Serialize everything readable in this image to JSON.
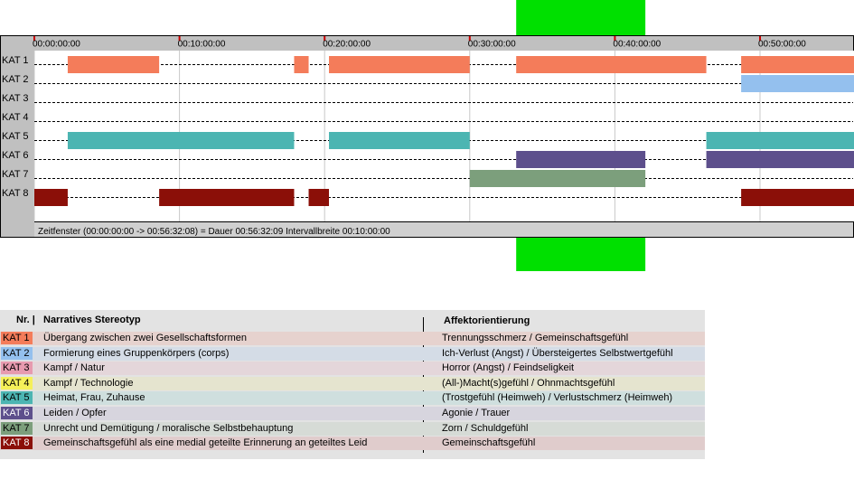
{
  "colors": {
    "highlight": "#00e000",
    "chart_bg": "#ffffff",
    "panel_bg": "#c0c0c0",
    "ruler_tick": "#cc0000"
  },
  "chart_data": {
    "type": "gantt",
    "time_ticks": [
      "00:00:00:00",
      "00:10:00:00",
      "00:20:00:00",
      "00:30:00:00",
      "00:40:00:00",
      "00:50:00:00"
    ],
    "x_range_minutes": [
      0,
      56.54
    ],
    "highlight_window_minutes": [
      33.2,
      42.1
    ],
    "categories": [
      "KAT 1",
      "KAT 2",
      "KAT 3",
      "KAT 4",
      "KAT 5",
      "KAT 6",
      "KAT 7",
      "KAT 8"
    ],
    "series": [
      {
        "category": "KAT 1",
        "color": "#f47c5a",
        "segments": [
          [
            2.3,
            8.6
          ],
          [
            17.9,
            18.9
          ],
          [
            20.3,
            30.0
          ],
          [
            33.2,
            46.3
          ],
          [
            48.7,
            56.54
          ]
        ]
      },
      {
        "category": "KAT 2",
        "color": "#94c0ee",
        "segments": [
          [
            48.7,
            56.54
          ]
        ]
      },
      {
        "category": "KAT 3",
        "color": "#e79aaf",
        "segments": []
      },
      {
        "category": "KAT 4",
        "color": "#f5f059",
        "segments": []
      },
      {
        "category": "KAT 5",
        "color": "#4cb5b2",
        "segments": [
          [
            2.3,
            17.9
          ],
          [
            20.3,
            30.0
          ],
          [
            46.3,
            56.54
          ]
        ]
      },
      {
        "category": "KAT 6",
        "color": "#5d4f8c",
        "segments": [
          [
            33.2,
            42.1
          ],
          [
            46.3,
            56.54
          ]
        ]
      },
      {
        "category": "KAT 7",
        "color": "#7c9f7c",
        "segments": [
          [
            30.0,
            42.1
          ]
        ]
      },
      {
        "category": "KAT 8",
        "color": "#8b0f08",
        "segments": [
          [
            0.0,
            2.3
          ],
          [
            8.6,
            17.9
          ],
          [
            18.9,
            20.3
          ],
          [
            48.7,
            56.54
          ]
        ]
      }
    ],
    "status_text": "Zeitfenster (00:00:00:00 -> 00:56:32:08) = Dauer 00:56:32:09    Intervallbreite 00:10:00:00"
  },
  "legend": {
    "header_nr": "Nr. |",
    "header_stereotyp": "Narratives Stereotyp",
    "header_affekt": "Affektorientierung",
    "rows": [
      {
        "code": "KAT 1",
        "name": "Übergang zwischen zwei Gesellschaftsformen",
        "affect": "Trennungsschmerz / Gemeinschaftsgefühl",
        "color": "#f47c5a",
        "bg": "#e6d2ce",
        "code_text": "#000000"
      },
      {
        "code": "KAT 2",
        "name": "Formierung eines Gruppenkörpers (corps)",
        "affect": "Ich-Verlust (Angst) / Übersteigertes Selbstwertgefühl",
        "color": "#94c0ee",
        "bg": "#d4dce6",
        "code_text": "#000000"
      },
      {
        "code": "KAT 3",
        "name": "Kampf / Natur",
        "affect": "Horror (Angst) / Feindseligkeit",
        "color": "#e79aaf",
        "bg": "#e4d6da",
        "code_text": "#000000"
      },
      {
        "code": "KAT 4",
        "name": "Kampf / Technologie",
        "affect": "(All-)Macht(s)gefühl / Ohnmachtsgefühl",
        "color": "#f5f059",
        "bg": "#e5e4cf",
        "code_text": "#000000"
      },
      {
        "code": "KAT 5",
        "name": "Heimat, Frau, Zuhause",
        "affect": "(Trostgefühl (Heimweh) / Verlustschmerz (Heimweh)",
        "color": "#4cb5b2",
        "bg": "#cfdfde",
        "code_text": "#000000"
      },
      {
        "code": "KAT 6",
        "name": "Leiden / Opfer",
        "affect": "Agonie / Trauer",
        "color": "#5d4f8c",
        "bg": "#d7d5de",
        "code_text": "#ffffff"
      },
      {
        "code": "KAT 7",
        "name": "Unrecht und Demütigung / moralische Selbstbehauptung",
        "affect": "Zorn / Schuldgefühl",
        "color": "#7c9f7c",
        "bg": "#d6dbd6",
        "code_text": "#000000"
      },
      {
        "code": "KAT 8",
        "name": "Gemeinschaftsgefühl als eine medial geteilte Erinnerung an geteiltes Leid",
        "affect": "Gemeinschaftsgefühl",
        "color": "#8b0f08",
        "bg": "#e0cccc",
        "code_text": "#ffffff"
      }
    ]
  }
}
